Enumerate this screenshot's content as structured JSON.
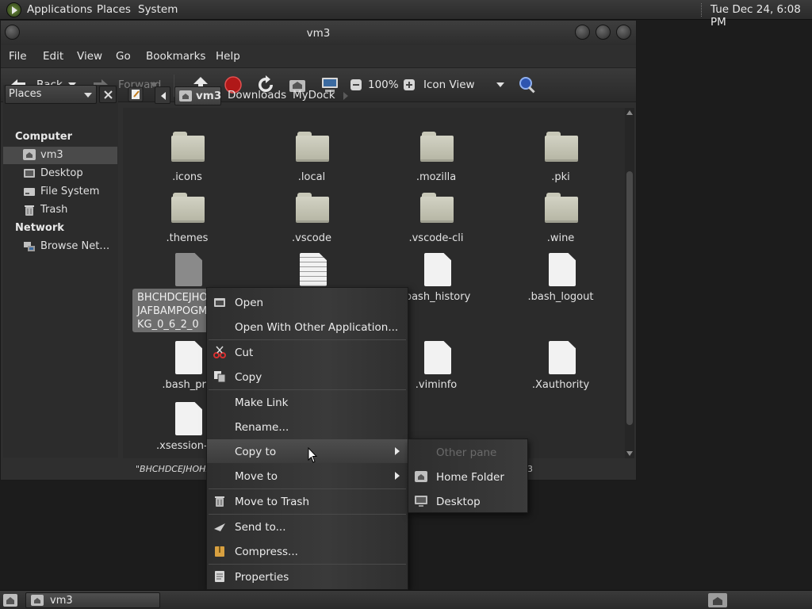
{
  "top_panel": {
    "menus": [
      "Applications",
      "Places",
      "System"
    ],
    "clock": "Tue Dec 24,  6:08 PM"
  },
  "window": {
    "title": "vm3",
    "menubar": [
      "File",
      "Edit",
      "View",
      "Go",
      "Bookmarks",
      "Help"
    ],
    "toolbar": {
      "back": "Back",
      "forward": "Forward",
      "zoom": "100%",
      "view_mode": "Icon View"
    },
    "sidebar": {
      "selector": "Places",
      "sections": [
        {
          "heading": "Computer",
          "items": [
            {
              "label": "vm3",
              "icon": "home-icon",
              "selected": true
            },
            {
              "label": "Desktop",
              "icon": "desktop-icon"
            },
            {
              "label": "File System",
              "icon": "drive-icon"
            },
            {
              "label": "Trash",
              "icon": "trash-icon"
            }
          ]
        },
        {
          "heading": "Network",
          "items": [
            {
              "label": "Browse Net…",
              "icon": "network-icon"
            }
          ]
        }
      ]
    },
    "breadcrumbs": [
      "vm3",
      "Downloads",
      "MyDock"
    ],
    "files": [
      {
        "name": ".icons",
        "type": "folder"
      },
      {
        "name": ".local",
        "type": "folder"
      },
      {
        "name": ".mozilla",
        "type": "folder"
      },
      {
        "name": ".pki",
        "type": "folder"
      },
      {
        "name": ".themes",
        "type": "folder"
      },
      {
        "name": ".vscode",
        "type": "folder"
      },
      {
        "name": ".vscode-cli",
        "type": "folder"
      },
      {
        "name": ".wine",
        "type": "folder"
      },
      {
        "name": "BHCHDCEJHO\nJAFBAMPOGM\nKG_0_6_2_0",
        "type": "file-selected"
      },
      {
        "name": "",
        "type": "text-file"
      },
      {
        "name": ".bash_history",
        "type": "file"
      },
      {
        "name": ".bash_logout",
        "type": "file"
      },
      {
        "name": ".bash_pro",
        "type": "file"
      },
      {
        "name": ".viminfo",
        "type": "file"
      },
      {
        "name": ".Xauthority",
        "type": "file"
      },
      {
        "name": ".xsession-er",
        "type": "file"
      }
    ],
    "status": "\"BHCHDCEJHOHF",
    "status_tail": "3"
  },
  "context_menu": {
    "items": [
      {
        "label": "Open",
        "icon": "folder-open-icon"
      },
      {
        "label": "Open With Other Application..."
      },
      {
        "label": "Cut",
        "icon": "scissors-icon"
      },
      {
        "label": "Copy",
        "icon": "copy-icon"
      },
      {
        "label": "Make Link"
      },
      {
        "label": "Rename..."
      },
      {
        "label": "Copy to",
        "submenu": true,
        "highlighted": true
      },
      {
        "label": "Move to",
        "submenu": true
      },
      {
        "label": "Move to Trash",
        "icon": "trash-icon"
      },
      {
        "label": "Send to...",
        "icon": "send-icon"
      },
      {
        "label": "Compress...",
        "icon": "archive-icon"
      },
      {
        "label": "Properties",
        "icon": "properties-icon"
      }
    ]
  },
  "submenu": {
    "items": [
      {
        "label": "Other pane",
        "disabled": true
      },
      {
        "label": "Home Folder",
        "icon": "home-icon"
      },
      {
        "label": "Desktop",
        "icon": "desktop-icon"
      }
    ]
  },
  "bottom_panel": {
    "task": "vm3"
  },
  "colors": {
    "background": "#1c1c1c",
    "window": "#2f2f2f",
    "highlight": "#4a4a4a",
    "stop_red": "#d42020",
    "search_blue": "#3a6bd8"
  }
}
